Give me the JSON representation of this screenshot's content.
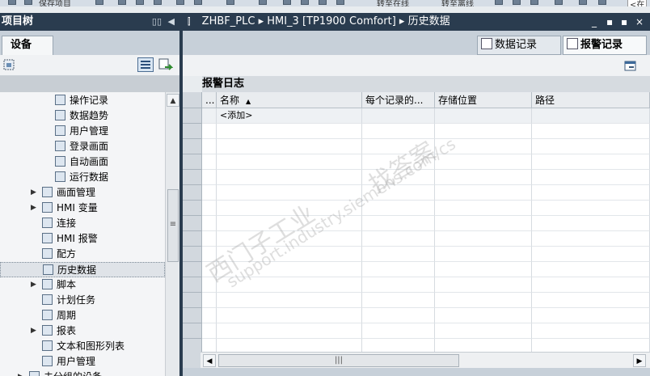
{
  "toolbar": {
    "save_project": "保存项目",
    "go_online": "转至在线",
    "go_offline": "转至离线",
    "search_placeholder": "<在"
  },
  "left_pane": {
    "title": "项目树",
    "tab": "设备",
    "tree": [
      {
        "label": "操作记录",
        "icon": "screen-icon",
        "indent": 68,
        "expander": false,
        "selected": false
      },
      {
        "label": "数据趋势",
        "icon": "screen-icon",
        "indent": 68,
        "expander": false,
        "selected": false
      },
      {
        "label": "用户管理",
        "icon": "screen-icon",
        "indent": 68,
        "expander": false,
        "selected": false
      },
      {
        "label": "登录画面",
        "icon": "start-screen-icon",
        "indent": 68,
        "expander": false,
        "selected": false
      },
      {
        "label": "自动画面",
        "icon": "screen-icon",
        "indent": 68,
        "expander": false,
        "selected": false
      },
      {
        "label": "运行数据",
        "icon": "screen-icon",
        "indent": 68,
        "expander": false,
        "selected": false
      },
      {
        "label": "画面管理",
        "icon": "folder-icon",
        "indent": 52,
        "expander": true,
        "selected": false
      },
      {
        "label": "HMI 变量",
        "icon": "tags-icon",
        "indent": 52,
        "expander": true,
        "selected": false
      },
      {
        "label": "连接",
        "icon": "connection-icon",
        "indent": 52,
        "expander": false,
        "selected": false
      },
      {
        "label": "HMI 报警",
        "icon": "alarm-icon",
        "indent": 52,
        "expander": false,
        "selected": false
      },
      {
        "label": "配方",
        "icon": "recipe-icon",
        "indent": 52,
        "expander": false,
        "selected": false
      },
      {
        "label": "历史数据",
        "icon": "history-icon",
        "indent": 52,
        "expander": false,
        "selected": true
      },
      {
        "label": "脚本",
        "icon": "script-icon",
        "indent": 52,
        "expander": true,
        "selected": false
      },
      {
        "label": "计划任务",
        "icon": "schedule-icon",
        "indent": 52,
        "expander": false,
        "selected": false
      },
      {
        "label": "周期",
        "icon": "cycle-icon",
        "indent": 52,
        "expander": false,
        "selected": false
      },
      {
        "label": "报表",
        "icon": "report-icon",
        "indent": 52,
        "expander": true,
        "selected": false
      },
      {
        "label": "文本和图形列表",
        "icon": "textlist-icon",
        "indent": 52,
        "expander": false,
        "selected": false
      },
      {
        "label": "用户管理",
        "icon": "user-icon",
        "indent": 52,
        "expander": false,
        "selected": false
      },
      {
        "label": "未分组的设备",
        "icon": "folder-icon",
        "indent": 36,
        "expander": true,
        "selected": false
      }
    ]
  },
  "editor": {
    "breadcrumb": [
      "ZHBF_PLC",
      "HMI_3 [TP1900 Comfort]",
      "历史数据"
    ],
    "window_buttons": [
      "_",
      "▪",
      "▪",
      "×"
    ],
    "tabs": [
      {
        "label": "数据记录",
        "active": false
      },
      {
        "label": "报警记录",
        "active": true
      }
    ],
    "table_title": "报警日志",
    "columns": [
      "...",
      "名称",
      "每个记录的...",
      "存储位置",
      "路径"
    ],
    "sort_indicator": "▲",
    "rows": [
      {
        "name": "<添加>"
      }
    ]
  },
  "watermark": {
    "line1": "西门子工业",
    "line2": "support.industry.siemens.com/cs",
    "line3": "找答案"
  }
}
